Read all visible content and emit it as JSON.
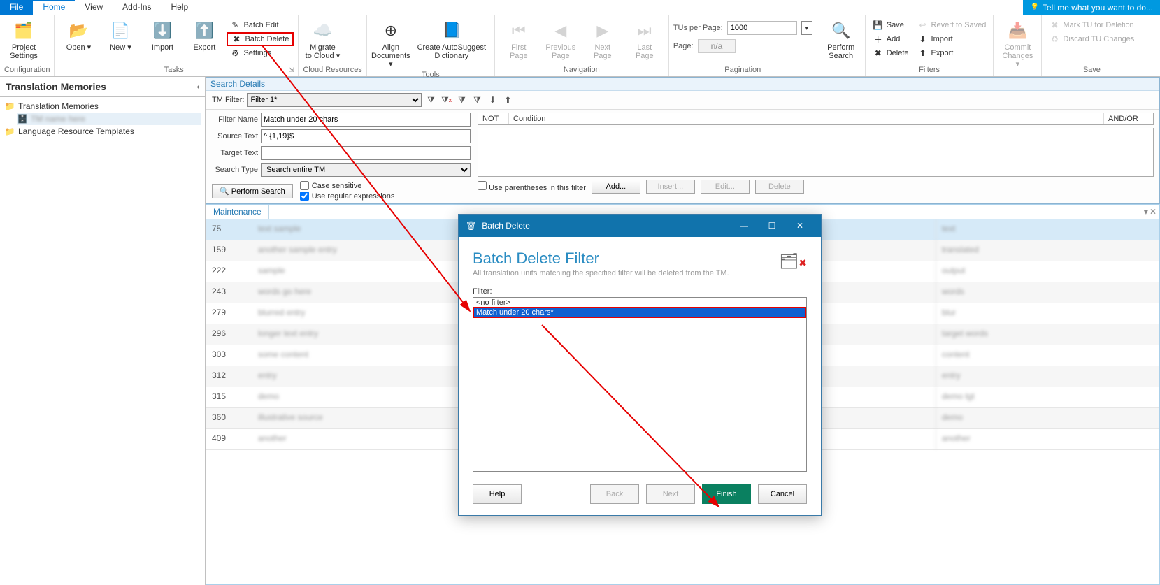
{
  "menu": {
    "file": "File",
    "home": "Home",
    "view": "View",
    "addins": "Add-Ins",
    "help": "Help",
    "tellme": "Tell me what you want to do..."
  },
  "ribbon": {
    "config": {
      "label": "Configuration",
      "project_settings": "Project\nSettings"
    },
    "tasks": {
      "label": "Tasks",
      "open": "Open",
      "new": "New",
      "import": "Import",
      "export": "Export",
      "batch_edit": "Batch Edit",
      "batch_delete": "Batch Delete",
      "settings": "Settings"
    },
    "cloud": {
      "label": "Cloud Resources",
      "migrate": "Migrate\nto Cloud"
    },
    "tools": {
      "label": "Tools",
      "align": "Align\nDocuments",
      "autosuggest": "Create AutoSuggest\nDictionary"
    },
    "nav": {
      "label": "Navigation",
      "first": "First\nPage",
      "prev": "Previous\nPage",
      "next": "Next\nPage",
      "last": "Last\nPage"
    },
    "pagination": {
      "label": "Pagination",
      "tus_per_page": "TUs per Page:",
      "tus_value": "1000",
      "page": "Page:",
      "page_value": "n/a"
    },
    "perform": {
      "label": "",
      "perform_search": "Perform\nSearch"
    },
    "filters": {
      "label": "Filters",
      "save": "Save",
      "add": "Add",
      "delete": "Delete",
      "revert": "Revert to Saved",
      "import": "Import",
      "export": "Export"
    },
    "commit": {
      "label": "",
      "commit": "Commit\nChanges"
    },
    "save": {
      "label": "Save",
      "mark": "Mark TU for Deletion",
      "discard": "Discard TU Changes"
    }
  },
  "left": {
    "title": "Translation Memories",
    "root": "Translation Memories",
    "child": "",
    "templates": "Language Resource Templates"
  },
  "search": {
    "header": "Search Details",
    "tm_filter_label": "TM Filter:",
    "tm_filter_value": "Filter 1*",
    "filter_name_label": "Filter Name",
    "filter_name_value": "Match under 20 chars",
    "source_label": "Source Text",
    "source_value": "^.{1,19}$",
    "target_label": "Target Text",
    "target_value": "",
    "type_label": "Search Type",
    "type_value": "Search entire TM",
    "perform": "Perform Search",
    "case_sensitive": "Case sensitive",
    "use_regex": "Use regular expressions",
    "cond": {
      "not": "NOT",
      "condition": "Condition",
      "andor": "AND/OR"
    },
    "use_paren": "Use parentheses in this filter",
    "add": "Add...",
    "insert": "Insert...",
    "edit": "Edit...",
    "delete": "Delete"
  },
  "maint": {
    "tab": "Maintenance",
    "rows": [
      {
        "n": "75",
        "s": "text sample",
        "t": "text"
      },
      {
        "n": "159",
        "s": "another sample entry",
        "t": "translated"
      },
      {
        "n": "222",
        "s": "sample",
        "t": "output"
      },
      {
        "n": "243",
        "s": "words go here",
        "t": "words"
      },
      {
        "n": "279",
        "s": "blurred entry",
        "t": "blur"
      },
      {
        "n": "296",
        "s": "longer text entry",
        "t": "target words"
      },
      {
        "n": "303",
        "s": "some content",
        "t": "content"
      },
      {
        "n": "312",
        "s": "entry",
        "t": "entry"
      },
      {
        "n": "315",
        "s": "demo",
        "t": "demo tgt"
      },
      {
        "n": "360",
        "s": "illustrative source",
        "t": "demo"
      },
      {
        "n": "409",
        "s": "another",
        "t": "another"
      }
    ]
  },
  "dialog": {
    "title": "Batch Delete",
    "heading": "Batch Delete Filter",
    "sub": "All translation units matching the specified filter will be deleted from the TM.",
    "filter_label": "Filter:",
    "opt_none": "<no filter>",
    "opt_match": "Match under 20 chars*",
    "help": "Help",
    "back": "Back",
    "next": "Next",
    "finish": "Finish",
    "cancel": "Cancel"
  }
}
